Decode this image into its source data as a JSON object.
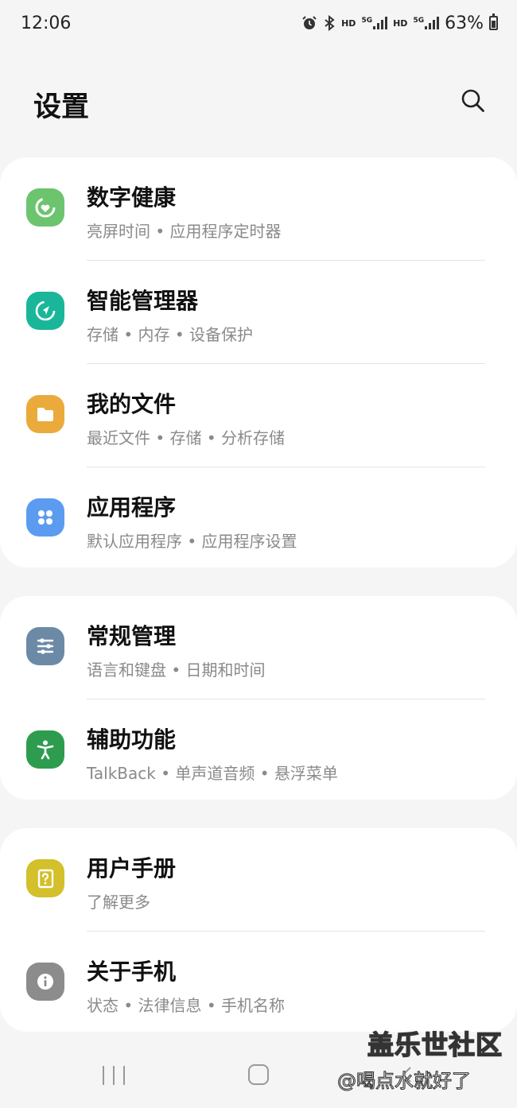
{
  "status_bar": {
    "time": "12:06",
    "icons": [
      "alarm-icon",
      "bluetooth-icon",
      "hd-icon",
      "5g-signal-icon",
      "hd-icon",
      "5g-signal-icon",
      "battery-icon"
    ],
    "hd_label": "HD",
    "net_label": "5G",
    "battery": "63%"
  },
  "header": {
    "title": "设置",
    "search_icon": "search-icon"
  },
  "groups": [
    {
      "items": [
        {
          "title": "数字健康",
          "subtitle": "亮屏时间 • 应用程序定时器",
          "icon": "digital-wellbeing-icon",
          "color": "#6cc46f"
        },
        {
          "title": "智能管理器",
          "subtitle": "存储 • 内存 • 设备保护",
          "icon": "device-care-icon",
          "color": "#1ab69a"
        },
        {
          "title": "我的文件",
          "subtitle": "最近文件 • 存储 • 分析存储",
          "icon": "folder-icon",
          "color": "#eaaa3c"
        },
        {
          "title": "应用程序",
          "subtitle": "默认应用程序 • 应用程序设置",
          "icon": "apps-icon",
          "color": "#5b9cf0"
        }
      ]
    },
    {
      "items": [
        {
          "title": "常规管理",
          "subtitle": "语言和键盘 • 日期和时间",
          "icon": "sliders-icon",
          "color": "#6c8aa6"
        },
        {
          "title": "辅助功能",
          "subtitle": "TalkBack • 单声道音频 • 悬浮菜单",
          "icon": "accessibility-icon",
          "color": "#2e9c4f"
        }
      ]
    },
    {
      "items": [
        {
          "title": "用户手册",
          "subtitle": "了解更多",
          "icon": "help-book-icon",
          "color": "#d3c02a"
        },
        {
          "title": "关于手机",
          "subtitle": "状态 • 法律信息 • 手机名称",
          "icon": "info-icon",
          "color": "#8c8c8c"
        }
      ]
    }
  ],
  "nav_bar": {
    "icons": [
      "recents-icon",
      "home-icon",
      "back-icon"
    ]
  },
  "watermark": {
    "line1": "盖乐世社区",
    "line2": "@喝点水就好了"
  }
}
